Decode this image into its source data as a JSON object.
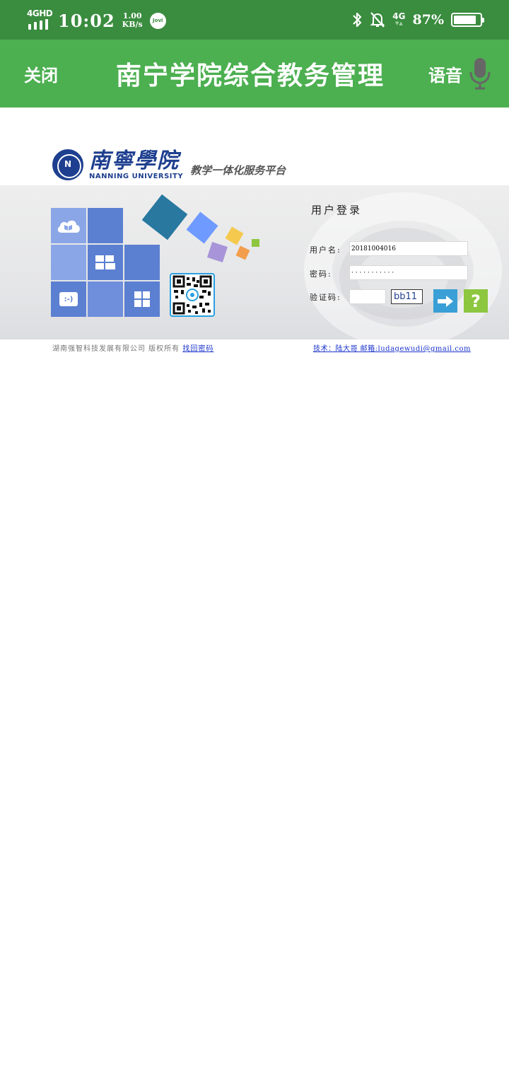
{
  "status_bar": {
    "network": "4GHD",
    "time": "10:02",
    "speed_value": "1.00",
    "speed_unit": "KB/s",
    "assistant": "Jovi",
    "network_right": "4G",
    "battery": "87%",
    "battery_level": 0.87
  },
  "header": {
    "close_label": "关闭",
    "title": "南宁学院综合教务管理",
    "voice_label": "语音"
  },
  "logo": {
    "name_cn": "南寧學院",
    "name_en": "NANNING UNIVERSITY",
    "slogan": "教学一体化服务平台"
  },
  "tiles": {
    "chat_icon_text": ":-)"
  },
  "login": {
    "title": "用户登录",
    "username_label": "用户名:",
    "username_value": "20181004016",
    "password_label": "密码:",
    "password_value": "· · · · · · · · · · ·",
    "captcha_label": "验证码:",
    "captcha_value": "",
    "captcha_image_text": "bb11"
  },
  "footer": {
    "copyright": "湖南强智科技发展有限公司 版权所有",
    "recover_link": "找回密码",
    "tech": "技术：陆大哥 邮箱:ludagewudi@gmail.com"
  },
  "colors": {
    "status_bar": "#3a8c3f",
    "header": "#4caf50",
    "tile_dark": "#5b7fd1",
    "tile_light": "#8aa6e6",
    "go_button": "#3a9fd6",
    "help_button": "#8dc63f"
  }
}
